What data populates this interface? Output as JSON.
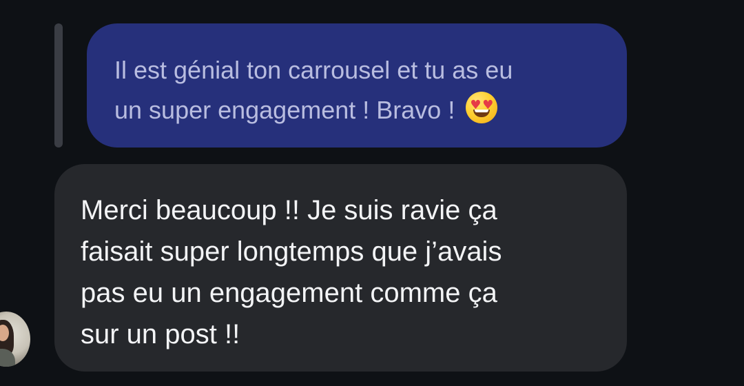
{
  "conversation": {
    "quoted_message": {
      "text": "Il est génial ton carrousel et tu as eu\nun super engagement ! Bravo ! ",
      "emoji_name": "smiling-face-with-heart-eyes"
    },
    "reply_message": {
      "text": "Merci beaucoup !! Je suis ravie ça\nfaisait super longtemps que j’avais\npas eu un engagement comme ça\nsur un post !!"
    }
  },
  "colors": {
    "background": "#0e1115",
    "quoted_bubble": "#26307b",
    "reply_bubble": "#26282c",
    "reply_bar": "#3a3d44",
    "quoted_text": "#b9bde0",
    "reply_text": "#f3f4f6"
  },
  "icons": {
    "avatar": "avatar",
    "emoji": "heart-eyes-emoji-icon"
  }
}
